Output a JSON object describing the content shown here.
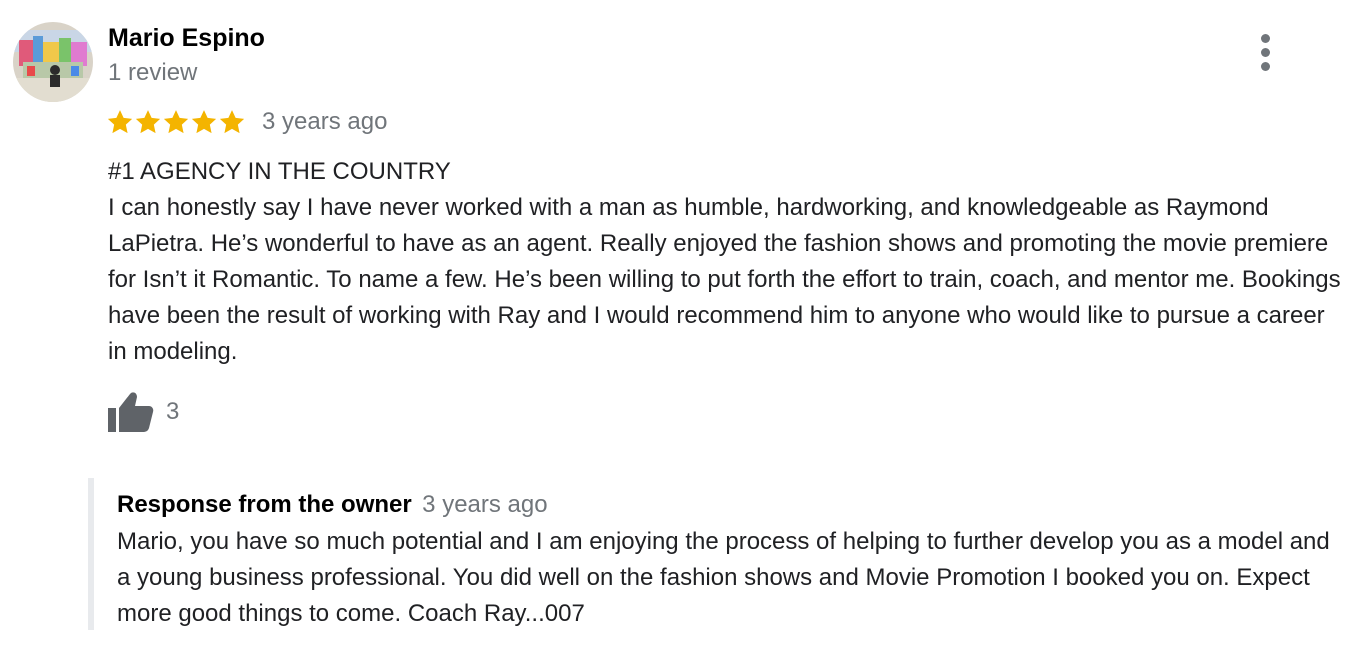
{
  "author": {
    "name": "Mario Espino",
    "review_count": "1 review"
  },
  "rating": {
    "stars": 5,
    "max_stars": 5,
    "star_color": "#f4b400",
    "time": "3 years ago"
  },
  "review": {
    "title": "#1 AGENCY IN THE COUNTRY",
    "text": "I can honestly say I have never worked with a man as humble, hardworking, and knowledgeable as Raymond LaPietra. He’s wonderful to have as an agent. Really enjoyed the fashion shows and promoting the movie premiere for Isn’t it Romantic. To name a few. He’s been willing to put forth the effort to train, coach, and mentor me. Bookings have been the result of working with Ray and I would recommend him to anyone who would like to pursue a career in modeling."
  },
  "likes": {
    "icon": "thumbs-up-icon",
    "count": "3"
  },
  "owner_response": {
    "title": "Response from the owner",
    "time": "3 years ago",
    "text": "Mario, you have so much potential and I am enjoying the process of helping to further develop you as a model and a young business professional. You did well on the fashion shows and Movie Promotion I booked you on. Expect more good things to come. Coach Ray...007"
  },
  "menu": {
    "icon": "more-vert-icon"
  },
  "colors": {
    "muted_text": "#70757a",
    "body_text": "#202124",
    "border": "#e8eaed"
  }
}
